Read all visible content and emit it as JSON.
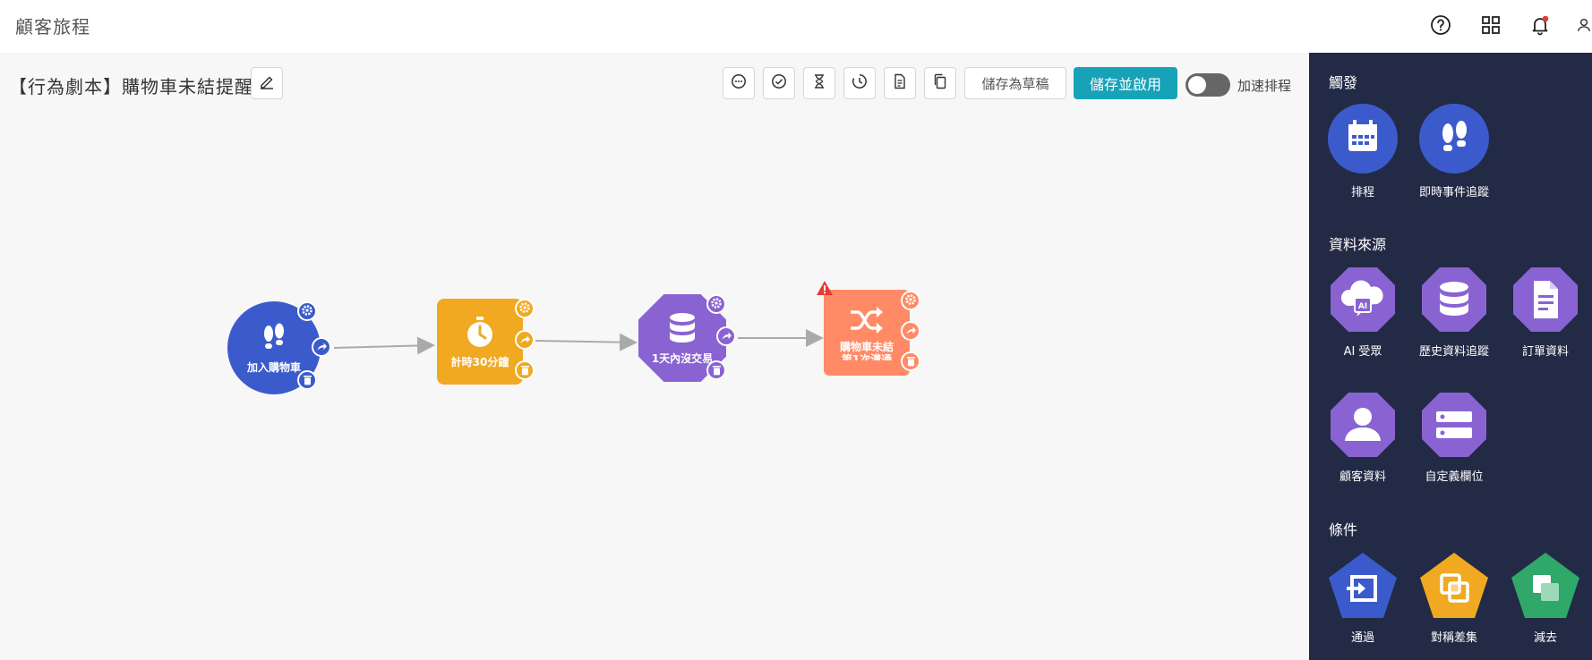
{
  "header": {
    "title": "顧客旅程",
    "icons": [
      "help-icon",
      "apps-grid-icon",
      "bell-icon",
      "user-icon"
    ]
  },
  "scenario": {
    "title": "【行為劇本】購物車未結提醒"
  },
  "toolbar": {
    "tools": [
      "comment-icon",
      "check-icon",
      "hourglass-icon",
      "history-icon",
      "document-icon",
      "copy-icon"
    ],
    "draft_label": "儲存為草稿",
    "save_label": "儲存並啟用",
    "toggle_label": "加速排程",
    "toggle_on": false
  },
  "flow": {
    "nodes": [
      {
        "label": "加入購物車",
        "icon": "footprints-icon",
        "color": "#3b5bcc"
      },
      {
        "label": "計時30分鐘",
        "icon": "stopwatch-icon",
        "color": "#f0a920"
      },
      {
        "label": "1天內沒交易",
        "icon": "database-icon",
        "color": "#8a63d2"
      },
      {
        "label": "購物車未結",
        "label2": "第1次溝通",
        "icon": "shuffle-icon",
        "color": "#ff8a65",
        "warning": true
      }
    ]
  },
  "panel": {
    "triggers": {
      "title": "觸發",
      "items": [
        {
          "label": "排程",
          "icon": "calendar-icon"
        },
        {
          "label": "即時事件追蹤",
          "icon": "footprints-icon"
        }
      ]
    },
    "sources": {
      "title": "資料來源",
      "items": [
        {
          "label": "AI 受眾",
          "icon": "ai-cloud-icon"
        },
        {
          "label": "歷史資料追蹤",
          "icon": "database-icon"
        },
        {
          "label": "訂單資料",
          "icon": "document-icon"
        },
        {
          "label": "顧客資料",
          "icon": "person-icon"
        },
        {
          "label": "自定義欄位",
          "icon": "fields-icon"
        }
      ]
    },
    "conditions": {
      "title": "條件",
      "items": [
        {
          "label": "通過",
          "icon": "enter-icon"
        },
        {
          "label": "對稱差集",
          "icon": "symmetric-diff-icon"
        },
        {
          "label": "減去",
          "icon": "subtract-icon"
        }
      ]
    }
  },
  "colors": {
    "accent": "#17a2b8",
    "panel_bg": "#232a45",
    "node_blue": "#3b5bcc",
    "node_orange": "#f0a920",
    "node_purple": "#8a63d2",
    "node_salmon": "#ff8a65",
    "cond_green": "#2fa86a",
    "notification_dot": "#e53935"
  }
}
